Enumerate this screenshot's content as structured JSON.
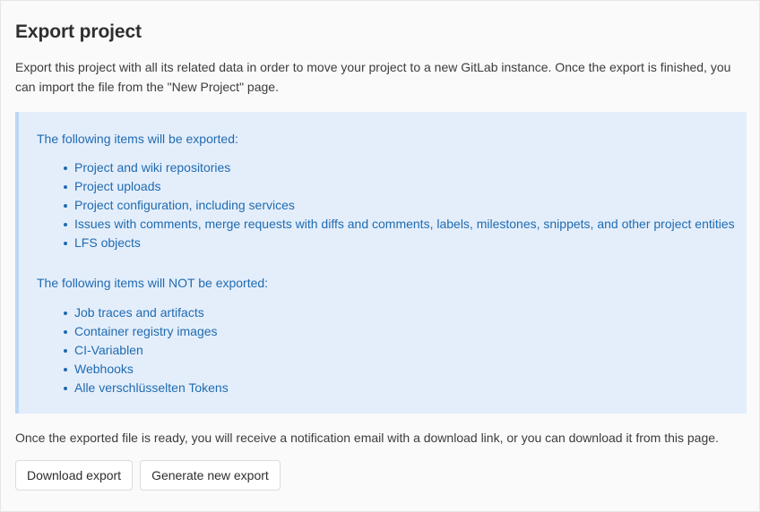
{
  "page": {
    "title": "Export project",
    "intro": "Export this project with all its related data in order to move your project to a new GitLab instance. Once the export is finished, you can import the file from the \"New Project\" page.",
    "footer_note": "Once the exported file is ready, you will receive a notification email with a download link, or you can download it from this page."
  },
  "info_box": {
    "accent_color": "#bdd8f3",
    "background_color": "#e4eefb",
    "text_color": "#1f6bb0",
    "included_heading": "The following items will be exported:",
    "included_items": [
      "Project and wiki repositories",
      "Project uploads",
      "Project configuration, including services",
      "Issues with comments, merge requests with diffs and comments, labels, milestones, snippets, and other project entities",
      "LFS objects"
    ],
    "excluded_heading": "The following items will NOT be exported:",
    "excluded_items": [
      "Job traces and artifacts",
      "Container registry images",
      "CI-Variablen",
      "Webhooks",
      "Alle verschlüsselten Tokens"
    ]
  },
  "actions": {
    "download_label": "Download export",
    "generate_label": "Generate new export"
  }
}
